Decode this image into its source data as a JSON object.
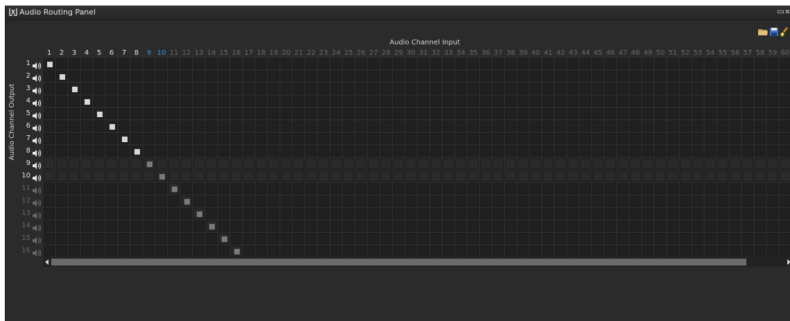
{
  "window": {
    "title": "Audio Routing Panel",
    "controls": [
      "restore",
      "close"
    ]
  },
  "toolbar": {
    "icons": [
      "folder-open-icon",
      "save-icon",
      "clear-brush-icon"
    ]
  },
  "matrix": {
    "x_axis_title": "Audio Channel Input",
    "y_axis_title": "Audio Channel Output",
    "input_labels": [
      "1",
      "2",
      "3",
      "4",
      "5",
      "6",
      "7",
      "8",
      "9",
      "10",
      "11",
      "12",
      "13",
      "14",
      "15",
      "16",
      "17",
      "18",
      "19",
      "20",
      "21",
      "22",
      "23",
      "24",
      "25",
      "26",
      "27",
      "28",
      "29",
      "30",
      "31",
      "32",
      "33",
      "34",
      "35",
      "36",
      "37",
      "38",
      "39",
      "40",
      "41",
      "42",
      "43",
      "44",
      "45",
      "46",
      "47",
      "48",
      "49",
      "50",
      "51",
      "52",
      "53",
      "54",
      "55",
      "56",
      "57",
      "58",
      "59",
      "60"
    ],
    "active_inputs": 10,
    "highlighted_inputs": [
      9,
      10
    ],
    "output_labels": [
      "1",
      "2",
      "3",
      "4",
      "5",
      "6",
      "7",
      "8",
      "9",
      "10",
      "11",
      "12",
      "13",
      "14",
      "15",
      "16"
    ],
    "enabled_outputs": 10,
    "dimmed_rows": [
      9,
      10
    ],
    "routes": [
      [
        1,
        1
      ],
      [
        2,
        2
      ],
      [
        3,
        3
      ],
      [
        4,
        4
      ],
      [
        5,
        5
      ],
      [
        6,
        6
      ],
      [
        7,
        7
      ],
      [
        8,
        8
      ],
      [
        9,
        9
      ],
      [
        10,
        10
      ],
      [
        11,
        11
      ],
      [
        12,
        12
      ],
      [
        13,
        13
      ],
      [
        14,
        14
      ],
      [
        15,
        15
      ],
      [
        16,
        16
      ]
    ]
  },
  "colors": {
    "panel_bg": "#2b2b2b",
    "label_active": "#e8e8e8",
    "label_highlight": "#3d8fe0",
    "label_inactive": "#6a6a6a",
    "route_on": "#d9d9d9",
    "route_on_dim": "#7a7a7a"
  }
}
